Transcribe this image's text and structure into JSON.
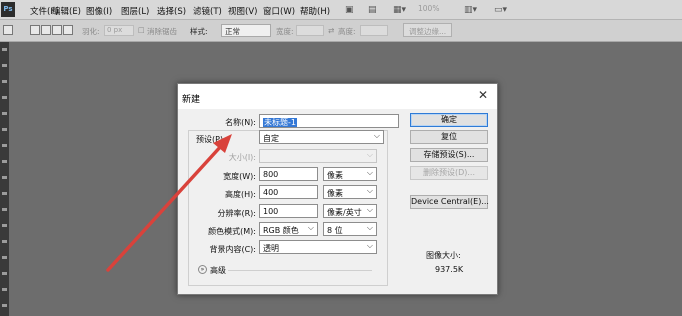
{
  "app": {
    "logo": "Ps"
  },
  "menubar": {
    "items": [
      "文件(F)",
      "编辑(E)",
      "图像(I)",
      "图层(L)",
      "选择(S)",
      "滤镜(T)",
      "视图(V)",
      "窗口(W)",
      "帮助(H)"
    ],
    "zoom": "100%"
  },
  "options": {
    "feather_label": "羽化:",
    "feather_value": "0 px",
    "antialias_label": "消除锯齿",
    "style_label": "样式:",
    "style_value": "正常",
    "width_label": "宽度:",
    "height_label": "高度:",
    "refine_edge": "调整边缘..."
  },
  "dialog": {
    "title": "新建",
    "name_label": "名称(N):",
    "name_value": "未标题-1",
    "preset_label": "预设(P):",
    "preset_value": "自定",
    "size_label": "大小(I):",
    "width_label": "宽度(W):",
    "width_value": "800",
    "width_unit": "像素",
    "height_label": "高度(H):",
    "height_value": "400",
    "height_unit": "像素",
    "resolution_label": "分辨率(R):",
    "resolution_value": "100",
    "resolution_unit": "像素/英寸",
    "color_mode_label": "颜色模式(M):",
    "color_mode_value": "RGB 颜色",
    "bit_depth_value": "8 位",
    "background_label": "背景内容(C):",
    "background_value": "透明",
    "advanced_label": "高级",
    "ok_button": "确定",
    "reset_button": "复位",
    "save_preset_button": "存储预设(S)...",
    "delete_preset_button": "删除预设(D)...",
    "device_central_button": "Device Central(E)...",
    "image_size_label": "图像大小:",
    "image_size_value": "937.5K"
  },
  "colors": {
    "annotation_arrow": "#d9423b",
    "ok_focus": "#2f7bd6",
    "selection": "#3478d6"
  }
}
